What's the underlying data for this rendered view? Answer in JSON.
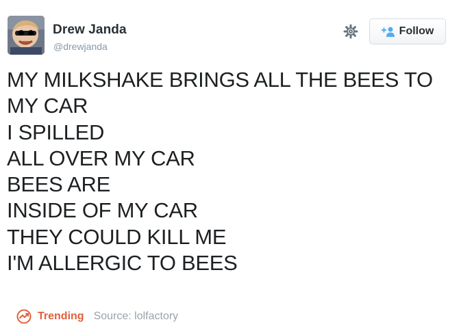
{
  "author": {
    "name": "Drew Janda",
    "handle": "@drewjanda"
  },
  "follow_button": {
    "label": "Follow",
    "icon": "add-user-icon"
  },
  "settings_icon": "gear-icon",
  "tweet": {
    "lines": [
      "MY MILKSHAKE BRINGS ALL THE BEES TO",
      "MY CAR",
      "I SPILLED",
      "ALL OVER MY CAR",
      "BEES ARE",
      "INSIDE OF MY CAR",
      "THEY COULD KILL ME",
      "I'M ALLERGIC TO BEES"
    ]
  },
  "footer": {
    "trending_label": "Trending",
    "trending_icon": "trending-icon",
    "source_text": "Source: lolfactory"
  },
  "colors": {
    "text": "#1c2022",
    "handle": "#8899a6",
    "trending": "#e0603c",
    "follow_accent": "#55acee"
  }
}
